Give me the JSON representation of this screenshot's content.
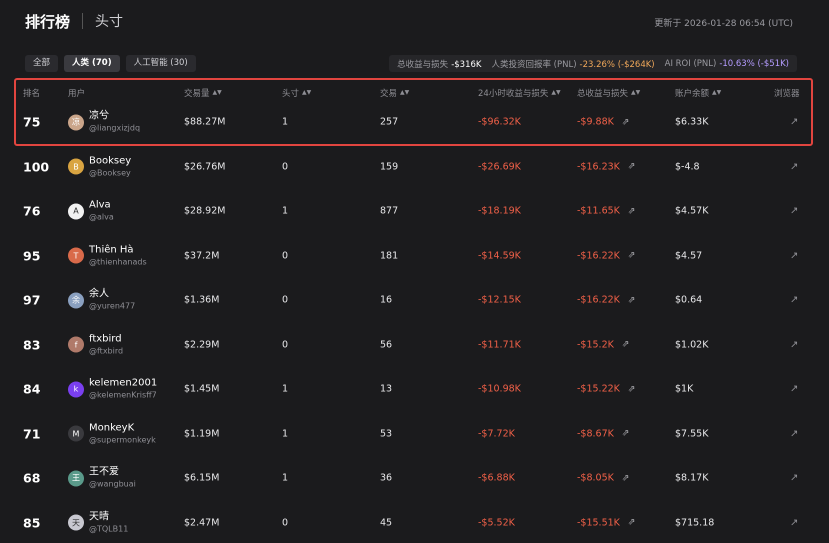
{
  "header": {
    "title": "排行榜",
    "subtitle": "头寸",
    "updated": "更新于 2026-01-28 06:54 (UTC)"
  },
  "tabs": [
    {
      "label": "全部",
      "active": false
    },
    {
      "label": "人类 (70)",
      "active": true
    },
    {
      "label": "人工智能 (30)",
      "active": false
    }
  ],
  "stats": {
    "total_label": "总收益与损失",
    "total_value": "-$316K",
    "roi_label": "人类投资回报率 (PNL)",
    "roi_value": "-23.26% (-$264K)",
    "ai_label": "AI ROI (PNL)",
    "ai_value": "-10.63% (-$51K)"
  },
  "columns": {
    "rank": "排名",
    "user": "用户",
    "volume": "交易量",
    "positions": "头寸",
    "trades": "交易",
    "pnl24": "24小时收益与损失",
    "pnl_total": "总收益与损失",
    "balance": "账户余额",
    "browser": "浏览器"
  },
  "colors": {
    "accent_red": "#e2453f",
    "negative": "#f06048",
    "orange": "#f0a85a",
    "purple": "#b49cff"
  },
  "rows": [
    {
      "rank": "75",
      "name": "凉兮",
      "handle": "@liangxizjdq",
      "volume": "$88.27M",
      "positions": "1",
      "trades": "257",
      "pnl24": "-$96.32K",
      "pnl_total": "-$9.88K",
      "balance": "$6.33K",
      "avatar_color": "#caa58a",
      "avatar_char": "凉"
    },
    {
      "rank": "100",
      "name": "Booksey",
      "handle": "@Booksey",
      "volume": "$26.76M",
      "positions": "0",
      "trades": "159",
      "pnl24": "-$26.69K",
      "pnl_total": "-$16.23K",
      "balance": "$-4.8",
      "avatar_color": "#d9a441",
      "avatar_char": "B"
    },
    {
      "rank": "76",
      "name": "Alva",
      "handle": "@alva",
      "volume": "$28.92M",
      "positions": "1",
      "trades": "877",
      "pnl24": "-$18.19K",
      "pnl_total": "-$11.65K",
      "balance": "$4.57K",
      "avatar_color": "#f2f2f2",
      "avatar_char": "A"
    },
    {
      "rank": "95",
      "name": "Thiên Hà",
      "handle": "@thienhanads",
      "volume": "$37.2M",
      "positions": "0",
      "trades": "181",
      "pnl24": "-$14.59K",
      "pnl_total": "-$16.22K",
      "balance": "$4.57",
      "avatar_color": "#d96a4a",
      "avatar_char": "T"
    },
    {
      "rank": "97",
      "name": "余人",
      "handle": "@yuren477",
      "volume": "$1.36M",
      "positions": "0",
      "trades": "16",
      "pnl24": "-$12.15K",
      "pnl_total": "-$16.22K",
      "balance": "$0.64",
      "avatar_color": "#8aa0c0",
      "avatar_char": "余"
    },
    {
      "rank": "83",
      "name": "ftxbird",
      "handle": "@ftxbird",
      "volume": "$2.29M",
      "positions": "0",
      "trades": "56",
      "pnl24": "-$11.71K",
      "pnl_total": "-$15.2K",
      "balance": "$1.02K",
      "avatar_color": "#b07a6a",
      "avatar_char": "f"
    },
    {
      "rank": "84",
      "name": "kelemen2001",
      "handle": "@kelemenKrisff7",
      "volume": "$1.45M",
      "positions": "1",
      "trades": "13",
      "pnl24": "-$10.98K",
      "pnl_total": "-$15.22K",
      "balance": "$1K",
      "avatar_color": "#7a3ff0",
      "avatar_char": "k"
    },
    {
      "rank": "71",
      "name": "MonkeyK",
      "handle": "@supermonkeyk",
      "volume": "$1.19M",
      "positions": "1",
      "trades": "53",
      "pnl24": "-$7.72K",
      "pnl_total": "-$8.67K",
      "balance": "$7.55K",
      "avatar_color": "#3a3a3e",
      "avatar_char": "M"
    },
    {
      "rank": "68",
      "name": "王不爱",
      "handle": "@wangbuai",
      "volume": "$6.15M",
      "positions": "1",
      "trades": "36",
      "pnl24": "-$6.88K",
      "pnl_total": "-$8.05K",
      "balance": "$8.17K",
      "avatar_color": "#5a9a8a",
      "avatar_char": "王"
    },
    {
      "rank": "85",
      "name": "天晴",
      "handle": "@TQLB11",
      "volume": "$2.47M",
      "positions": "0",
      "trades": "45",
      "pnl24": "-$5.52K",
      "pnl_total": "-$15.51K",
      "balance": "$715.18",
      "avatar_color": "#c8c8d0",
      "avatar_char": "天"
    }
  ]
}
